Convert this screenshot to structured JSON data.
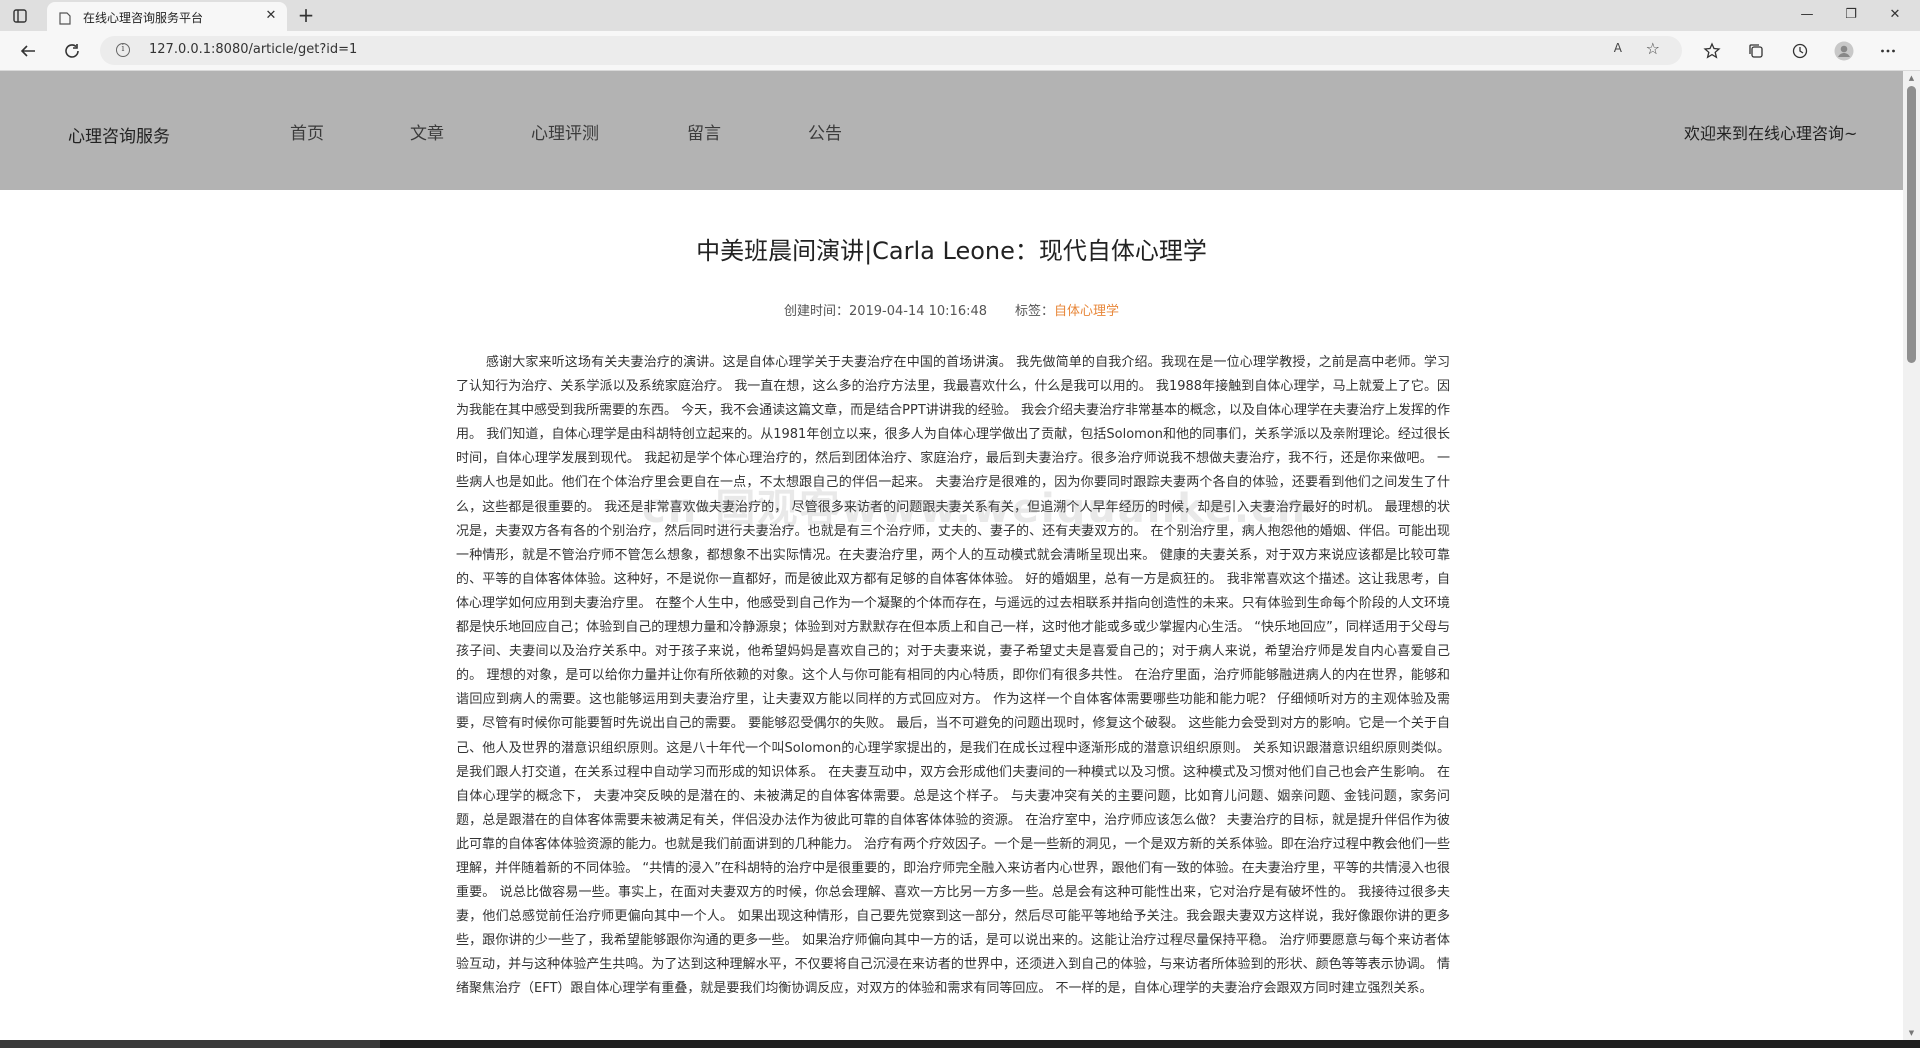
{
  "browser": {
    "tab_title": "在线心理咨询服务平台",
    "tab_close": "✕",
    "new_tab": "+",
    "url": "127.0.0.1:8080/article/get?id=1",
    "read_aloud": "A",
    "win_minimize": "—",
    "win_restore": "❐",
    "win_close": "✕"
  },
  "header": {
    "brand": "心理咨询服务",
    "nav": [
      {
        "label": "首页"
      },
      {
        "label": "文章"
      },
      {
        "label": "心理评测"
      },
      {
        "label": "留言"
      },
      {
        "label": "公告"
      }
    ],
    "welcome": "欢迎来到在线心理咨询~"
  },
  "article": {
    "title": "中美班晨间演讲|Carla Leone：现代自体心理学",
    "created_label": "创建时间：",
    "created_value": "2019-04-14 10:16:48",
    "tag_label": "标签：",
    "tag_value": "自体心理学",
    "body": "感谢大家来听这场有关夫妻治疗的演讲。这是自体心理学关于夫妻治疗在中国的首场讲演。 我先做简单的自我介绍。我现在是一位心理学教授，之前是高中老师。学习了认知行为治疗、关系学派以及系统家庭治疗。 我一直在想，这么多的治疗方法里，我最喜欢什么，什么是我可以用的。 我1988年接触到自体心理学，马上就爱上了它。因为我能在其中感受到我所需要的东西。 今天，我不会通读这篇文章，而是结合PPT讲讲我的经验。 我会介绍夫妻治疗非常基本的概念，以及自体心理学在夫妻治疗上发挥的作用。 我们知道，自体心理学是由科胡特创立起来的。从1981年创立以来，很多人为自体心理学做出了贡献，包括Solomon和他的同事们，关系学派以及亲附理论。经过很长时间，自体心理学发展到现代。 我起初是学个体心理治疗的，然后到团体治疗、家庭治疗，最后到夫妻治疗。很多治疗师说我不想做夫妻治疗，我不行，还是你来做吧。 一些病人也是如此。他们在个体治疗里会更自在一点，不太想跟自己的伴侣一起来。 夫妻治疗是很难的，因为你要同时跟踪夫妻两个各自的体验，还要看到他们之间发生了什么，这些都是很重要的。 我还是非常喜欢做夫妻治疗的， 尽管很多来访者的问题跟夫妻关系有关，但追溯个人早年经历的时候，却是引入夫妻治疗最好的时机。 最理想的状况是，夫妻双方各有各的个别治疗，然后同时进行夫妻治疗。也就是有三个治疗师，丈夫的、妻子的、还有夫妻双方的。 在个别治疗里，病人抱怨他的婚姻、伴侣。可能出现一种情形，就是不管治疗师不管怎么想象，都想象不出实际情况。在夫妻治疗里，两个人的互动模式就会清晰呈现出来。 健康的夫妻关系，对于双方来说应该都是比较可靠的、平等的自体客体体验。这种好，不是说你一直都好，而是彼此双方都有足够的自体客体体验。 好的婚姻里，总有一方是疯狂的。 我非常喜欢这个描述。这让我思考，自体心理学如何应用到夫妻治疗里。 在整个人生中，他感受到自己作为一个凝聚的个体而存在，与遥远的过去相联系并指向创造性的未来。只有体验到生命每个阶段的人文环境都是快乐地回应自己；体验到自己的理想力量和冷静源泉；体验到对方默默存在但本质上和自己一样，这时他才能或多或少掌握内心生活。 “快乐地回应”，同样适用于父母与孩子间、夫妻间以及治疗关系中。对于孩子来说，他希望妈妈是喜欢自己的；对于夫妻来说，妻子希望丈夫是喜爱自己的；对于病人来说，希望治疗师是发自内心喜爱自己的。 理想的对象，是可以给你力量并让你有所依赖的对象。这个人与你可能有相同的内心特质，即你们有很多共性。 在治疗里面，治疗师能够融进病人的内在世界，能够和谐回应到病人的需要。这也能够运用到夫妻治疗里，让夫妻双方能以同样的方式回应对方。 作为这样一个自体客体需要哪些功能和能力呢？ 仔细倾听对方的主观体验及需要，尽管有时候你可能要暂时先说出自己的需要。 要能够忍受偶尔的失败。 最后，当不可避免的问题出现时，修复这个破裂。 这些能力会受到对方的影响。它是一个关于自己、他人及世界的潜意识组织原则。这是八十年代一个叫Solomon的心理学家提出的，是我们在成长过程中逐渐形成的潜意识组织原则。 关系知识跟潜意识组织原则类似。是我们跟人打交道，在关系过程中自动学习而形成的知识体系。 在夫妻互动中，双方会形成他们夫妻间的一种模式以及习惯。这种模式及习惯对他们自己也会产生影响。 在自体心理学的概念下， 夫妻冲突反映的是潜在的、未被满足的自体客体需要。总是这个样子。 与夫妻冲突有关的主要问题，比如育儿问题、姻亲问题、金钱问题，家务问题，总是跟潜在的自体客体需要未被满足有关，伴侣没办法作为彼此可靠的自体客体体验的资源。 在治疗室中，治疗师应该怎么做？ 夫妻治疗的目标，就是提升伴侣作为彼此可靠的自体客体体验资源的能力。也就是我们前面讲到的几种能力。 治疗有两个疗效因子。一个是一些新的洞见，一个是双方新的关系体验。即在治疗过程中教会他们一些理解，并伴随着新的不同体验。 “共情的浸入”在科胡特的治疗中是很重要的，即治疗师完全融入来访者内心世界，跟他们有一致的体验。在夫妻治疗里，平等的共情浸入也很重要。 说总比做容易一些。事实上，在面对夫妻双方的时候，你总会理解、喜欢一方比另一方多一些。总是会有这种可能性出来，它对治疗是有破坏性的。 我接待过很多夫妻，他们总感觉前任治疗师更偏向其中一个人。 如果出现这种情形，自己要先觉察到这一部分，然后尽可能平等地给予关注。我会跟夫妻双方这样说，我好像跟你讲的更多些，跟你讲的少一些了，我希望能够跟你沟通的更多一些。 如果治疗师偏向其中一方的话，是可以说出来的。这能让治疗过程尽量保持平稳。 治疗师要愿意与每个来访者体验互动，并与这种体验产生共鸣。为了达到这种理解水平，不仅要将自己沉浸在来访者的世界中，还须进入到自己的体验，与来访者所体验到的形状、颜色等等表示协调。 情绪聚焦治疗（EFT）跟自体心理学有重叠，就是要我们均衡协调反应，对双方的体验和需求有同等回应。 不一样的是，自体心理学的夫妻治疗会跟双方同时建立强烈关系。",
    "watermark": "cn·国观客www.weiquanke.cn"
  }
}
